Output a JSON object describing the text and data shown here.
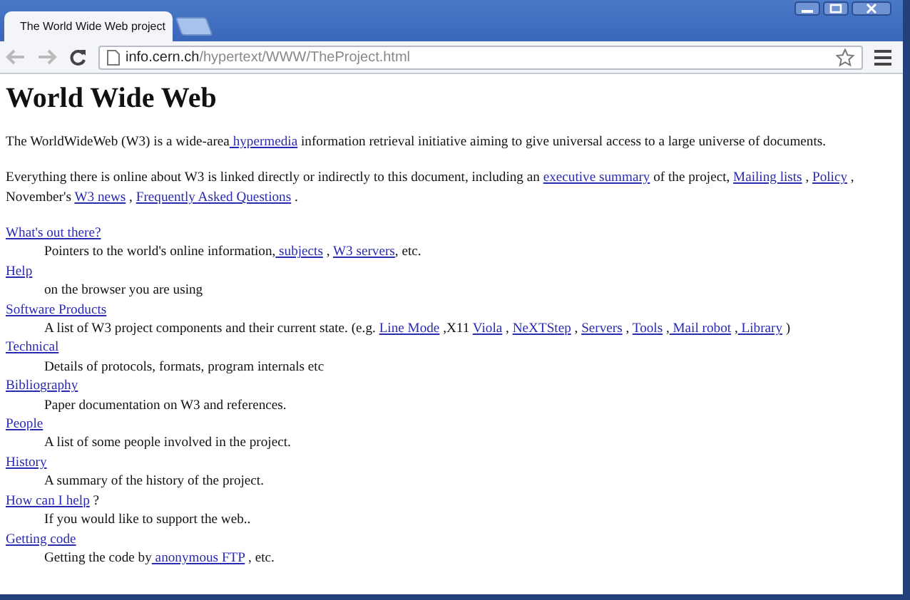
{
  "tab": {
    "title": "The World Wide Web project",
    "selected": true
  },
  "address": {
    "host": "info.cern.ch",
    "path": "/hypertext/WWW/TheProject.html"
  },
  "heading": "World Wide Web",
  "paragraphs": [
    [
      {
        "text": "The WorldWideWeb (W3) is a wide-area",
        "link": false
      },
      {
        "text": " hypermedia",
        "link": true
      },
      {
        "text": " information retrieval initiative aiming to give universal access to a large universe of documents.",
        "link": false
      }
    ],
    [
      {
        "text": "Everything there is online about W3 is linked directly or indirectly to this document, including an ",
        "link": false
      },
      {
        "text": "executive summary",
        "link": true
      },
      {
        "text": " of the project, ",
        "link": false
      },
      {
        "text": "Mailing lists",
        "link": true
      },
      {
        "text": " , ",
        "link": false
      },
      {
        "text": "Policy",
        "link": true
      },
      {
        "text": " , November's ",
        "link": false
      },
      {
        "text": "W3 news",
        "link": true
      },
      {
        "text": " , ",
        "link": false
      },
      {
        "text": "Frequently Asked Questions",
        "link": true
      },
      {
        "text": " .",
        "link": false
      }
    ]
  ],
  "entries": [
    {
      "term": "What's out there?",
      "description": [
        {
          "text": "Pointers to the world's online information,",
          "link": false
        },
        {
          "text": " subjects",
          "link": true
        },
        {
          "text": " , ",
          "link": false
        },
        {
          "text": "W3 servers",
          "link": true
        },
        {
          "text": ", etc.",
          "link": false
        }
      ]
    },
    {
      "term": "Help",
      "description": [
        {
          "text": "on the browser you are using",
          "link": false
        }
      ]
    },
    {
      "term": "Software Products",
      "description": [
        {
          "text": "A list of W3 project components and their current state. (e.g. ",
          "link": false
        },
        {
          "text": "Line Mode",
          "link": true
        },
        {
          "text": " ,X11 ",
          "link": false
        },
        {
          "text": "Viola",
          "link": true
        },
        {
          "text": " , ",
          "link": false
        },
        {
          "text": "NeXTStep",
          "link": true
        },
        {
          "text": " , ",
          "link": false
        },
        {
          "text": "Servers",
          "link": true
        },
        {
          "text": " , ",
          "link": false
        },
        {
          "text": "Tools",
          "link": true
        },
        {
          "text": " ,",
          "link": false
        },
        {
          "text": " Mail robot",
          "link": true
        },
        {
          "text": " ,",
          "link": false
        },
        {
          "text": " Library",
          "link": true
        },
        {
          "text": " )",
          "link": false
        }
      ]
    },
    {
      "term": "Technical",
      "description": [
        {
          "text": "Details of protocols, formats, program internals etc",
          "link": false
        }
      ]
    },
    {
      "term": "Bibliography",
      "description": [
        {
          "text": "Paper documentation on W3 and references.",
          "link": false
        }
      ]
    },
    {
      "term": "People",
      "description": [
        {
          "text": "A list of some people involved in the project.",
          "link": false
        }
      ]
    },
    {
      "term": "History",
      "description": [
        {
          "text": "A summary of the history of the project.",
          "link": false
        }
      ]
    },
    {
      "term": "How can I help",
      "term_suffix": " ?",
      "description": [
        {
          "text": "If you would like to support the web..",
          "link": false
        }
      ]
    },
    {
      "term": "Getting code",
      "description": [
        {
          "text": "Getting the code by",
          "link": false
        },
        {
          "text": " anonymous FTP",
          "link": true
        },
        {
          "text": " , etc.",
          "link": false
        }
      ]
    }
  ]
}
